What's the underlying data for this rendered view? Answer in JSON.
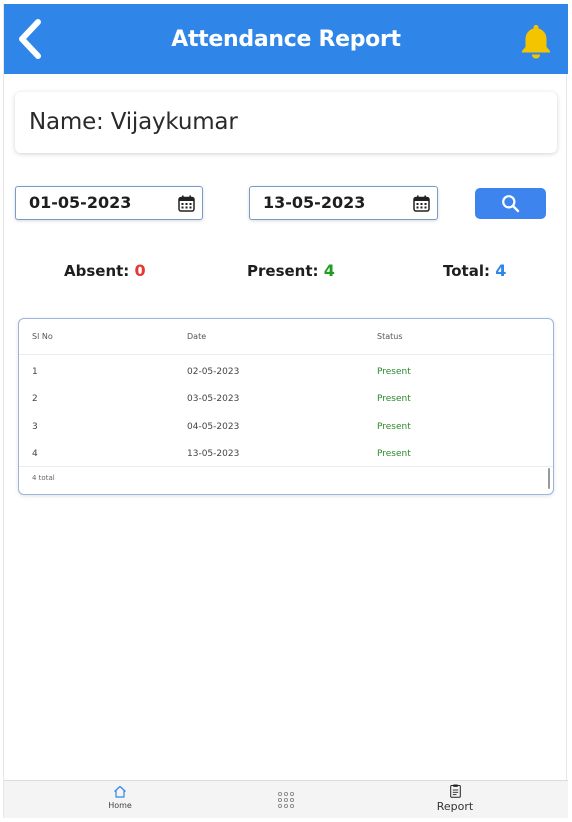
{
  "header": {
    "title": "Attendance Report",
    "back_icon": "chevron-left-icon",
    "bell_icon": "bell-icon"
  },
  "colors": {
    "header_bg": "#2f86e8",
    "accent": "#3d84ee",
    "absent": "#e53935",
    "present": "#1f9d1f",
    "total": "#2f86e8",
    "bell": "#f5c400"
  },
  "profile": {
    "name_text": "Name: Vijaykumar"
  },
  "filters": {
    "from_date": "01-05-2023",
    "to_date": "13-05-2023",
    "calendar_icon": "calendar-icon",
    "search_icon": "search-icon"
  },
  "summary": {
    "absent_label": "Absent:",
    "absent_value": "0",
    "present_label": "Present:",
    "present_value": "4",
    "total_label": "Total:",
    "total_value": "4"
  },
  "table": {
    "columns": [
      "Sl No",
      "Date",
      "Status"
    ],
    "rows": [
      [
        "1",
        "02-05-2023",
        "Present"
      ],
      [
        "2",
        "03-05-2023",
        "Present"
      ],
      [
        "3",
        "04-05-2023",
        "Present"
      ],
      [
        "4",
        "13-05-2023",
        "Present"
      ]
    ],
    "footer": "4 total"
  },
  "bottom_nav": {
    "home_label": "Home",
    "home_icon": "home-icon",
    "menu_icon": "grid-icon",
    "report_label": "Report",
    "report_icon": "clipboard-icon"
  }
}
